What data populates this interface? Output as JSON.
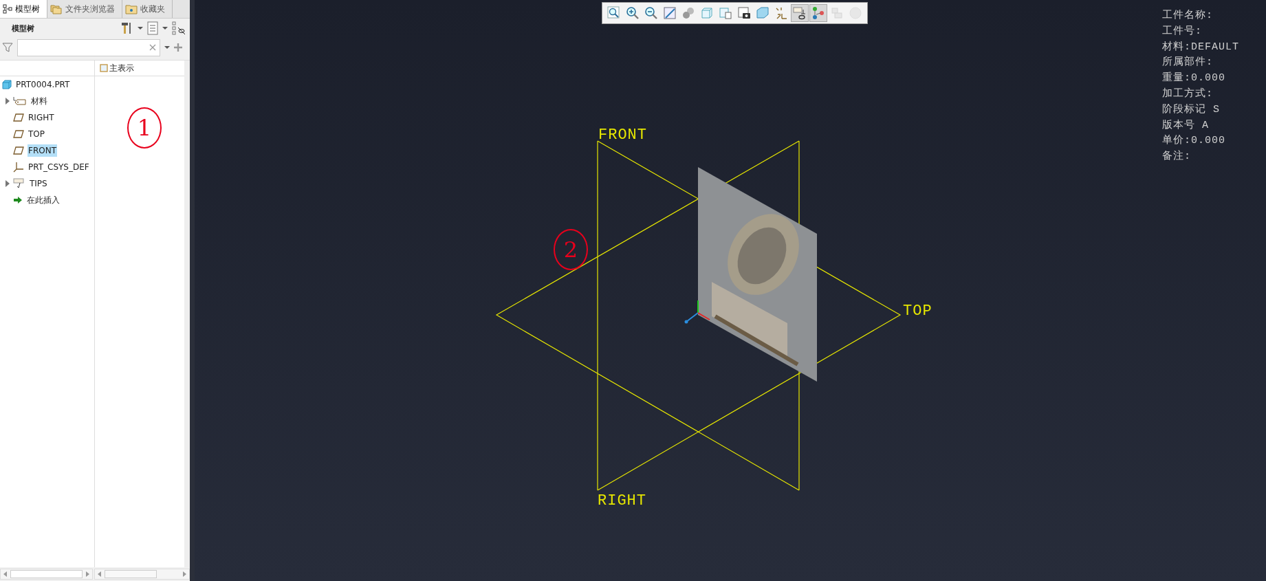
{
  "panel": {
    "tabs": [
      {
        "label": "模型树",
        "selected": true,
        "kind": "tree"
      },
      {
        "label": "文件夹浏览器",
        "selected": false,
        "kind": "folders"
      },
      {
        "label": "收藏夹",
        "selected": false,
        "kind": "favorites"
      }
    ],
    "title": "模型树",
    "columns": [
      "主表示"
    ],
    "tree": {
      "label": "PRT0004.PRT",
      "kind": "part",
      "selected": false,
      "children": [
        {
          "label": "材料",
          "kind": "material",
          "selected": false,
          "expanded": false
        },
        {
          "label": "RIGHT",
          "kind": "plane",
          "selected": false
        },
        {
          "label": "TOP",
          "kind": "plane",
          "selected": false
        },
        {
          "label": "FRONT",
          "kind": "plane",
          "selected": true
        },
        {
          "label": "PRT_CSYS_DEF",
          "kind": "csys",
          "selected": false
        },
        {
          "label": "TIPS",
          "kind": "notes",
          "selected": false,
          "expanded": false
        },
        {
          "label": "在此插入",
          "kind": "insert",
          "selected": false
        }
      ]
    }
  },
  "toolbar": [
    {
      "kind": "zoom-fit",
      "selected": false,
      "disabled": false
    },
    {
      "kind": "zoom-in",
      "selected": false,
      "disabled": false
    },
    {
      "kind": "zoom-out",
      "selected": false,
      "disabled": false
    },
    {
      "kind": "repaint",
      "selected": false,
      "disabled": false
    },
    {
      "kind": "shading",
      "selected": false,
      "disabled": false
    },
    {
      "kind": "view",
      "selected": false,
      "disabled": false
    },
    {
      "kind": "saved-views",
      "selected": false,
      "disabled": false
    },
    {
      "kind": "snapshot",
      "selected": false,
      "disabled": false
    },
    {
      "kind": "display-style",
      "selected": false,
      "disabled": false
    },
    {
      "kind": "datum",
      "selected": false,
      "disabled": false
    },
    {
      "kind": "annotations",
      "selected": true,
      "disabled": false
    },
    {
      "kind": "connector",
      "selected": true,
      "disabled": false
    },
    {
      "kind": "blocks",
      "selected": false,
      "disabled": true
    },
    {
      "kind": "circle",
      "selected": false,
      "disabled": true
    }
  ],
  "datum_planes": [
    "FRONT",
    "TOP",
    "RIGHT"
  ],
  "info": [
    "工件名称:",
    "工件号:",
    "材料:DEFAULT",
    "所属部件:",
    "重量:0.000",
    "加工方式:",
    "阶段标记 S",
    "版本号 A",
    "单价:0.000",
    "备注:"
  ],
  "annotations": [
    {
      "label": "1"
    },
    {
      "label": "2"
    }
  ]
}
